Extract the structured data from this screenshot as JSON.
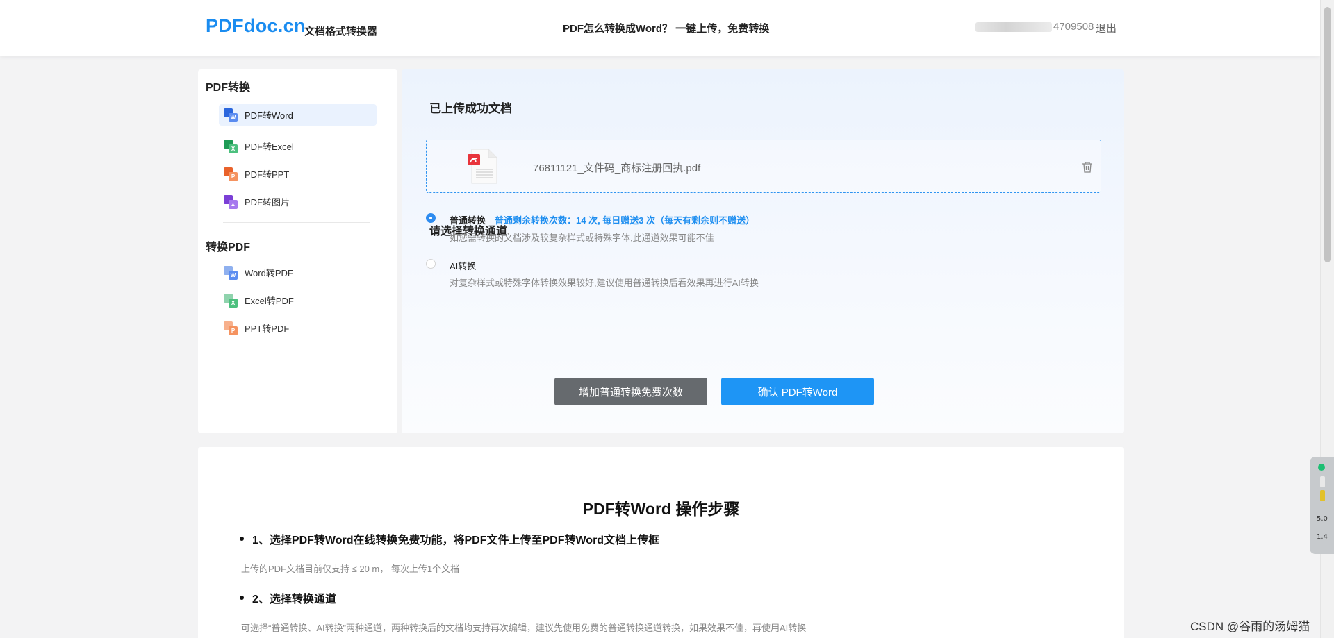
{
  "header": {
    "logo": "PDFdoc.cn",
    "logo_sub": "文档格式转换器",
    "center_text": "PDF怎么转换成Word？ 一键上传，免费转换",
    "user_visible": "4709508",
    "logout": "退出"
  },
  "sidebar": {
    "section1_title": "PDF转换",
    "section1_items": [
      {
        "label": "PDF转Word",
        "icon": "word-icon",
        "active": true
      },
      {
        "label": "PDF转Excel",
        "icon": "excel-icon",
        "active": false
      },
      {
        "label": "PDF转PPT",
        "icon": "ppt-icon",
        "active": false
      },
      {
        "label": "PDF转图片",
        "icon": "image-icon",
        "active": false
      }
    ],
    "section2_title": "转换PDF",
    "section2_items": [
      {
        "label": "Word转PDF",
        "icon": "word-icon"
      },
      {
        "label": "Excel转PDF",
        "icon": "excel-icon"
      },
      {
        "label": "PPT转PDF",
        "icon": "ppt-icon"
      }
    ]
  },
  "main": {
    "uploaded_title": "已上传成功文档",
    "file_name": "76811121_文件码_商标注册回执.pdf",
    "channel_title": "请选择转换通道",
    "options": [
      {
        "label": "普通转换",
        "note": "普通剩余转换次数：14 次, 每日赠送3 次（每天有剩余则不赠送）",
        "desc": "如您需转换的文档涉及较复杂样式或特殊字体,此通道效果可能不佳",
        "selected": true
      },
      {
        "label": "AI转换",
        "note": "",
        "desc": "对复杂样式或特殊字体转换效果较好,建议使用普通转换后看效果再进行AI转换",
        "selected": false
      }
    ],
    "btn_add": "增加普通转换免费次数",
    "btn_confirm": "确认 PDF转Word"
  },
  "article": {
    "title": "PDF转Word 操作步骤",
    "steps": [
      {
        "title": "1、选择PDF转Word在线转换免费功能，将PDF文件上传至PDF转Word文档上传框",
        "desc": "上传的PDF文档目前仅支持 ≤ 20 m， 每次上传1个文档"
      },
      {
        "title": "2、选择转换通道",
        "desc": "可选择“普通转换、AI转换”两种通道，两种转换后的文档均支持再次编辑，建议先使用免费的普通转换通道转换，如果效果不佳，再使用AI转换"
      }
    ]
  },
  "float_tool": {
    "val1": "5.0",
    "val2": "1.4"
  },
  "watermark": "CSDN @谷雨的汤姆猫",
  "colors": {
    "accent": "#1e95f5",
    "logo": "#1a8cf0",
    "note": "#1e8ef0",
    "gray_button": "#666a6e"
  }
}
